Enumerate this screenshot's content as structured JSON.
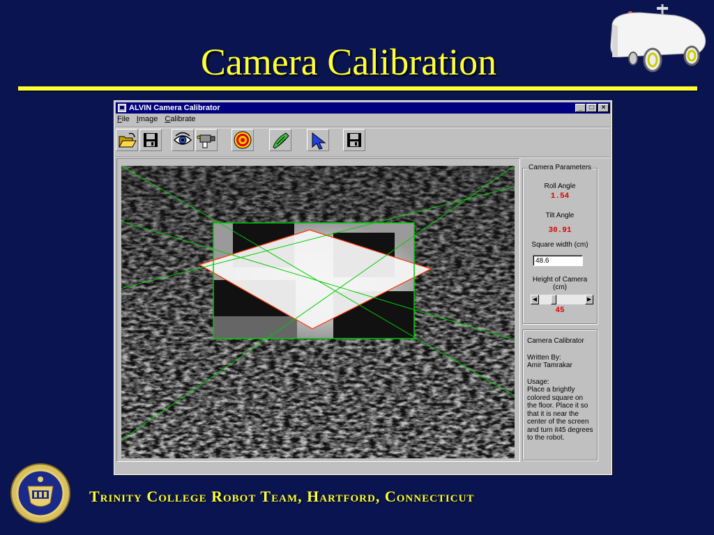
{
  "slide": {
    "title": "Camera Calibration",
    "footer": "Trinity College Robot Team, Hartford, Connecticut"
  },
  "window": {
    "title": "ALVIN Camera Calibrator",
    "buttons": {
      "minimize": "_",
      "maximize": "□",
      "close": "×"
    }
  },
  "menu": [
    {
      "label": "File"
    },
    {
      "label": "Image"
    },
    {
      "label": "Calibrate"
    }
  ],
  "toolbar": [
    {
      "name": "open-icon"
    },
    {
      "name": "save-icon"
    },
    {
      "name": "view-eye-icon"
    },
    {
      "name": "camera-icon"
    },
    {
      "name": "target-icon"
    },
    {
      "name": "calibrate-brush-icon"
    },
    {
      "name": "pointer-icon"
    },
    {
      "name": "save-icon"
    }
  ],
  "params": {
    "caption": "Camera Parameters",
    "roll_label": "Roll Angle",
    "roll_value": "1.54",
    "tilt_label": "Tilt Angle",
    "tilt_value": "30.91",
    "square_label": "Square width (cm)",
    "square_value": "48.6",
    "height_label": "Height of Camera (cm)",
    "height_value": "45",
    "height_slider_fraction": 0.3
  },
  "about": {
    "title": "Camera Calibrator",
    "written_by_label": "Written By:",
    "author": "Amir Tamrakar",
    "usage_label": "Usage:",
    "usage_text": "Place a brightly colored square on the floor.  Place it so that it is near the center of the screen and turn it45 degrees to the robot."
  },
  "colors": {
    "slide_bg": "#0a1450",
    "title": "#ffff33",
    "titlebar": "#000080",
    "value_red": "#e00000",
    "line_green": "#00cc00",
    "line_red": "#ff3300"
  }
}
